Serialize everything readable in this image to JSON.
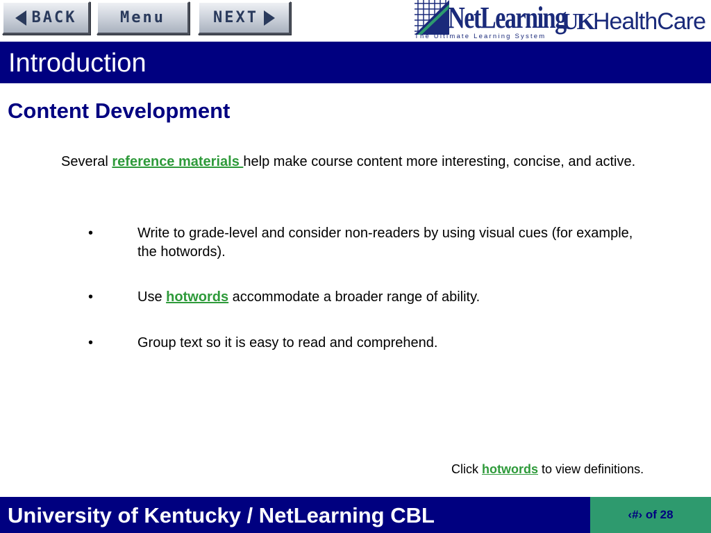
{
  "nav": {
    "back_label": "BACK",
    "menu_label": "Menu",
    "next_label": "NEXT"
  },
  "logos": {
    "netlearning": "NetLearning",
    "netlearning_tagline": "The Ultimate Learning System",
    "uk_prefix": "UK",
    "uk_suffix": "HealthCare"
  },
  "header": {
    "title": "Introduction"
  },
  "content": {
    "subtitle": "Content Development",
    "intro_before": "Several ",
    "intro_link": "reference materials ",
    "intro_after": "help make course content more interesting, concise, and active.",
    "bullets": [
      {
        "marker": "•",
        "text": "Write to grade-level and consider non-readers by using visual cues (for example, the hotwords)."
      },
      {
        "marker": "•",
        "before": "Use ",
        "link": "hotwords",
        "after": " accommodate a broader range of ability."
      },
      {
        "marker": "•",
        "text": "Group text so it is easy to read and comprehend."
      }
    ],
    "note_before": "Click ",
    "note_link": "hotwords",
    "note_after": " to view definitions."
  },
  "footer": {
    "org": "University of Kentucky / NetLearning CBL",
    "page_current": "‹#›",
    "page_of": " of 28"
  },
  "colors": {
    "navy": "#000080",
    "link_green": "#2e9a3a",
    "footer_green": "#2e9a6e"
  }
}
